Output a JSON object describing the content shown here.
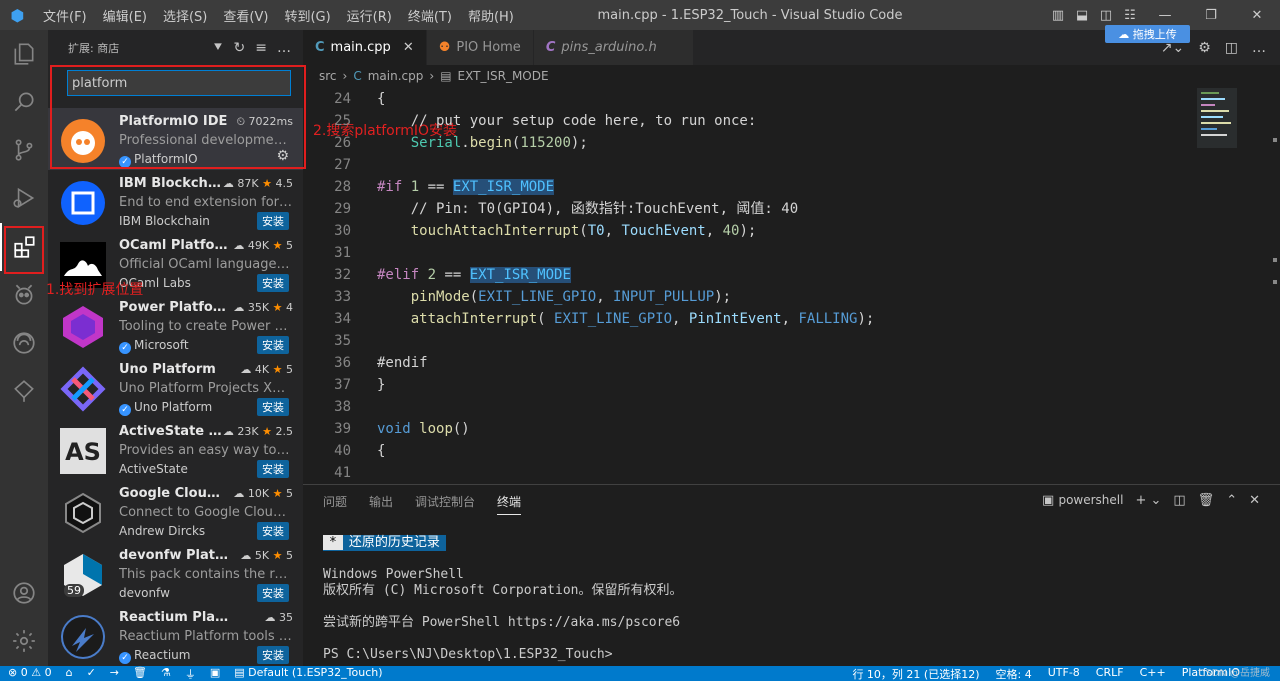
{
  "window": {
    "title": "main.cpp - 1.ESP32_Touch - Visual Studio Code",
    "menu": [
      "文件(F)",
      "编辑(E)",
      "选择(S)",
      "查看(V)",
      "转到(G)",
      "运行(R)",
      "终端(T)",
      "帮助(H)"
    ]
  },
  "sidebar": {
    "header": "扩展: 商店",
    "search_value": "platform",
    "extensions": [
      {
        "name": "PlatformIO IDE",
        "stats": "7022ms",
        "desc": "Professional development e...",
        "publisher": "PlatformIO",
        "verified": true,
        "action": "gear"
      },
      {
        "name": "IBM Blockchai...",
        "downloads": "87K",
        "rating": "4.5",
        "desc": "End to end extension for Hy...",
        "publisher": "IBM Blockchain",
        "verified": false,
        "action": "安装"
      },
      {
        "name": "OCaml Platform",
        "downloads": "49K",
        "rating": "5",
        "desc": "Official OCaml language ext...",
        "publisher": "OCaml Labs",
        "verified": false,
        "action": "安装"
      },
      {
        "name": "Power Platfor...",
        "downloads": "35K",
        "rating": "4",
        "desc": "Tooling to create Power Plat...",
        "publisher": "Microsoft",
        "verified": true,
        "action": "安装"
      },
      {
        "name": "Uno Platform",
        "downloads": "4K",
        "rating": "5",
        "desc": "Uno Platform Projects XAML...",
        "publisher": "Uno Platform",
        "verified": true,
        "action": "安装"
      },
      {
        "name": "ActiveState Pl...",
        "downloads": "23K",
        "rating": "2.5",
        "desc": "Provides an easy way to virt...",
        "publisher": "ActiveState",
        "verified": false,
        "action": "安装"
      },
      {
        "name": "Google Cloud P...",
        "downloads": "10K",
        "rating": "5",
        "desc": "Connect to Google Cloud V...",
        "publisher": "Andrew Dircks",
        "verified": false,
        "action": "安装"
      },
      {
        "name": "devonfw Platfor...",
        "downloads": "5K",
        "rating": "5",
        "desc": "This pack contains the reco...",
        "publisher": "devonfw",
        "verified": false,
        "action": "安装",
        "badge": "59"
      },
      {
        "name": "Reactium Platform",
        "downloads": "35",
        "rating": "",
        "desc": "Reactium Platform tools for ...",
        "publisher": "Reactium",
        "verified": true,
        "action": "安装"
      }
    ]
  },
  "annotations": {
    "step1": "1.找到扩展位置",
    "step2": "2.搜索platformIO安装"
  },
  "tabs": [
    {
      "label": "main.cpp",
      "icon": "C",
      "active": true
    },
    {
      "label": "PIO Home",
      "icon": "pio",
      "active": false
    },
    {
      "label": "pins_arduino.h",
      "icon": "C",
      "active": false
    }
  ],
  "cloud_button": "拖拽上传",
  "breadcrumb": [
    "src",
    "main.cpp",
    "EXT_ISR_MODE"
  ],
  "code_lines": [
    "24",
    "25",
    "26",
    "27",
    "28",
    "29",
    "30",
    "31",
    "32",
    "33",
    "34",
    "35",
    "36",
    "37",
    "38",
    "39",
    "40",
    "41"
  ],
  "panel": {
    "tabs": [
      "问题",
      "输出",
      "调试控制台",
      "终端"
    ],
    "shell": "powershell",
    "restored": "还原的历史记录",
    "terminal_lines": [
      "Windows PowerShell",
      "版权所有 (C) Microsoft Corporation。保留所有权利。",
      "",
      "尝试新的跨平台 PowerShell https://aka.ms/pscore6",
      "",
      "PS C:\\Users\\NJ\\Desktop\\1.ESP32_Touch>"
    ]
  },
  "statusbar": {
    "errors": "0",
    "warnings": "0",
    "project": "Default (1.ESP32_Touch)",
    "position": "行 10，列 21 (已选择12)",
    "indent": "空格: 4",
    "encoding": "UTF-8",
    "eol": "CRLF",
    "language": "C++",
    "platform": "PlatformIO",
    "watermark": "CSDN @岳捷威"
  }
}
